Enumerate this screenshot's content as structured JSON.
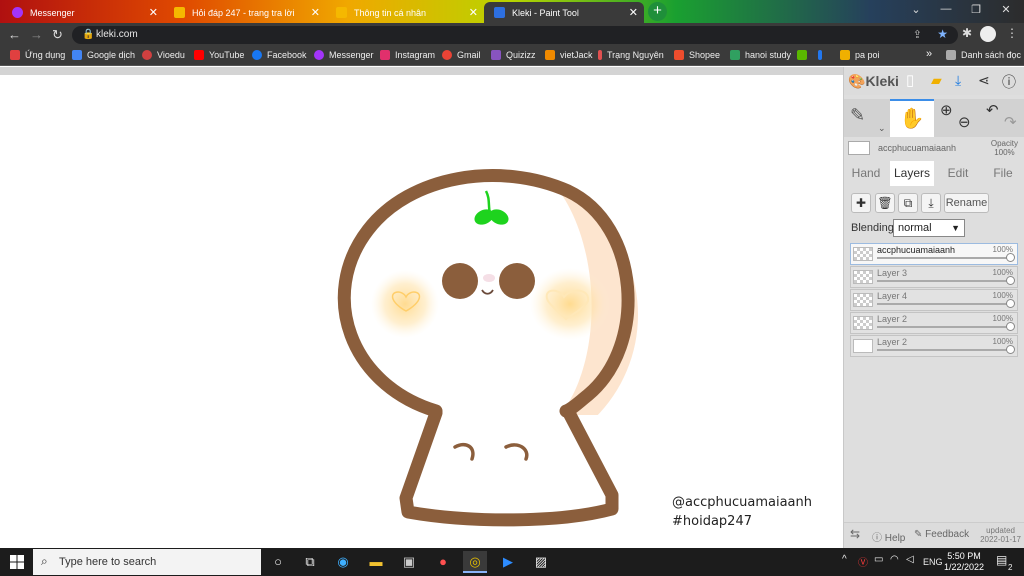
{
  "browser": {
    "tabs": [
      {
        "title": "Messenger",
        "icon": "messenger-icon",
        "color": "#a334fa"
      },
      {
        "title": "Hỏi đáp 247 - trang tra lời",
        "icon": "hoidap-icon",
        "color": "#f5b800"
      },
      {
        "title": "Thông tin cá nhân",
        "icon": "hoidap-icon",
        "color": "#f5b800"
      },
      {
        "title": "Kleki - Paint Tool",
        "icon": "kleki-icon",
        "color": "#2d6fe0"
      }
    ],
    "url": "kleki.com",
    "bookmarks": [
      {
        "label": "Ứng dụng",
        "color": "#e04040"
      },
      {
        "label": "Google dịch",
        "color": "#4285f4"
      },
      {
        "label": "Vioedu",
        "color": "#d04040"
      },
      {
        "label": "YouTube",
        "color": "#ff0000"
      },
      {
        "label": "Facebook",
        "color": "#1877f2"
      },
      {
        "label": "Messenger",
        "color": "#a334fa"
      },
      {
        "label": "Instagram",
        "color": "#e1306c"
      },
      {
        "label": "Gmail",
        "color": "#ea4335"
      },
      {
        "label": "Quizizz",
        "color": "#8854c0"
      },
      {
        "label": "vietJack",
        "color": "#f08a00"
      },
      {
        "label": "Trạng Nguyên",
        "color": "#e05050"
      },
      {
        "label": "Shopee",
        "color": "#ee4d2d"
      },
      {
        "label": "hanoi study",
        "color": "#30a060"
      },
      {
        "label": "",
        "color": "#5ab800"
      },
      {
        "label": "",
        "color": "#2277ee"
      },
      {
        "label": "pa poi",
        "color": "#f0b000"
      }
    ],
    "more_bookmarks": "»",
    "reading_list": "Danh sách đọc"
  },
  "canvas": {
    "signature_handle": "@accphucuamaiaanh",
    "signature_tag": "#hoidap247",
    "colors": {
      "outline": "#8b5e3c",
      "sprout": "#1ed31e",
      "blush": "#ffd98a",
      "shade": "#fde5cf"
    }
  },
  "kleki": {
    "logo": "Kleki",
    "layer_name": "accphucuamaiaanh",
    "opacity_label": "Opacity",
    "opacity_value": "100%",
    "tabs": [
      "Hand",
      "Layers",
      "Edit",
      "File"
    ],
    "active_tab": "Layers",
    "rename_label": "Rename",
    "blending_label": "Blending",
    "blending_value": "normal",
    "layers": [
      {
        "name": "accphucuamaiaanh",
        "opacity": "100%",
        "selected": true
      },
      {
        "name": "Layer 3",
        "opacity": "100%",
        "selected": false
      },
      {
        "name": "Layer 4",
        "opacity": "100%",
        "selected": false
      },
      {
        "name": "Layer 2",
        "opacity": "100%",
        "selected": false
      },
      {
        "name": "Layer 2",
        "opacity": "100%",
        "selected": false
      }
    ],
    "footer": {
      "help": "Help",
      "feedback": "Feedback",
      "updated_label": "updated",
      "updated_date": "2022-01-17"
    }
  },
  "taskbar": {
    "search_placeholder": "Type here to search",
    "language": "ENG",
    "time": "5:50 PM",
    "date": "1/22/2022",
    "notifications": "2"
  }
}
